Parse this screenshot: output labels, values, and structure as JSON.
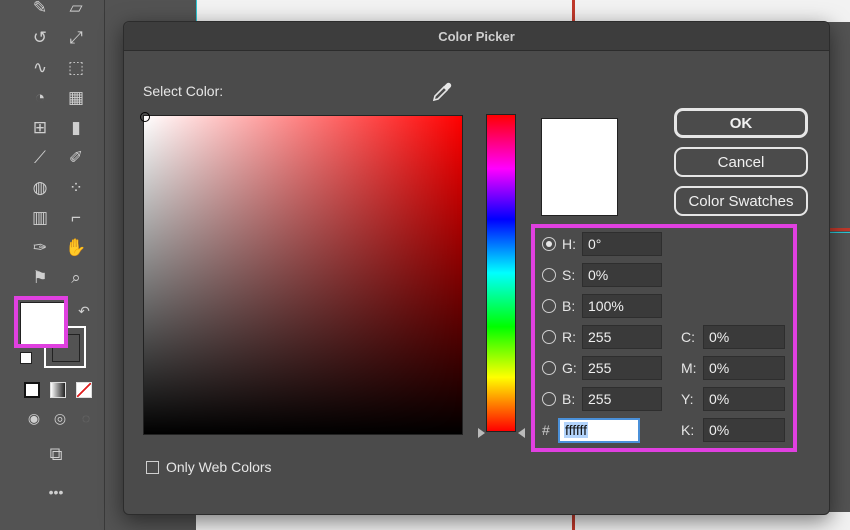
{
  "dialog": {
    "title": "Color Picker",
    "select_color_label": "Select Color:",
    "only_web_colors_label": "Only Web Colors",
    "only_web_colors_checked": false,
    "current_color": "#ffffff",
    "buttons": {
      "ok": "OK",
      "cancel": "Cancel",
      "swatches": "Color Swatches"
    },
    "hsb": [
      {
        "label": "H:",
        "value": "0°",
        "selected": true
      },
      {
        "label": "S:",
        "value": "0%",
        "selected": false
      },
      {
        "label": "B:",
        "value": "100%",
        "selected": false
      }
    ],
    "rgb": [
      {
        "label": "R:",
        "value": "255",
        "selected": false
      },
      {
        "label": "G:",
        "value": "255",
        "selected": false
      },
      {
        "label": "B:",
        "value": "255",
        "selected": false
      }
    ],
    "hex": {
      "label": "#",
      "value": "ffffff"
    },
    "cmyk": [
      {
        "label": "C:",
        "value": "0%"
      },
      {
        "label": "M:",
        "value": "0%"
      },
      {
        "label": "Y:",
        "value": "0%"
      },
      {
        "label": "K:",
        "value": "0%"
      }
    ]
  },
  "toolbar": {
    "tools": [
      "pencil-icon",
      "eraser-icon",
      "rotate-icon",
      "scale-icon",
      "warp-icon",
      "free-transform-icon",
      "shape-builder-icon",
      "perspective-grid-icon",
      "mesh-icon",
      "gradient-icon",
      "eyedropper-icon",
      "blend-icon",
      "symbol-sprayer-icon",
      "graph-icon",
      "artboard-icon",
      "slice-icon",
      "hand-icon",
      "puppet-warp-icon",
      "zoom-icon"
    ],
    "fill_color": "#ffffff",
    "more_label": "•••"
  },
  "colors": {
    "highlight": "#e040e0",
    "accent": "#4a90d9"
  }
}
